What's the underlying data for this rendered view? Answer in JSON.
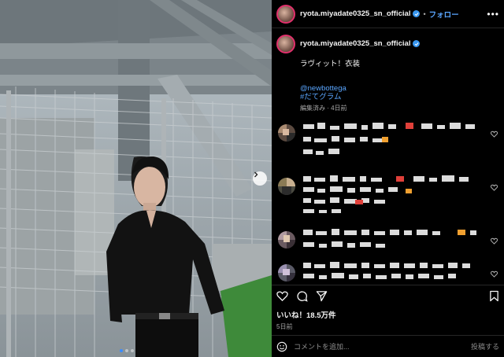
{
  "post": {
    "username": "ryota.miyadate0325_sn_official",
    "separator": "•",
    "follow_label": "フォロー",
    "more_label": "•••",
    "caption_text": "ラヴィット！衣装",
    "tags": [
      "@newbottega",
      "#だてグラム"
    ],
    "caption_meta": "編集済み · 4日前",
    "likes": "いいね！18.5万件",
    "posted_ago": "5日前",
    "comment_placeholder": "コメントを追加...",
    "post_label": "投稿する",
    "carousel": {
      "slide_count": 3,
      "active_slide": 1
    }
  },
  "icons": {
    "avatar": "avatar-image",
    "verified": "verified-badge-icon",
    "heart": "heart-icon",
    "comment": "comment-icon",
    "share": "share-icon",
    "bookmark": "bookmark-icon",
    "emoji": "emoji-icon",
    "next": "chevron-right-icon"
  },
  "colors": {
    "accent": "#5aa6ff",
    "verified": "#3897f0",
    "background": "#000000",
    "muted": "#a8a8a8"
  }
}
